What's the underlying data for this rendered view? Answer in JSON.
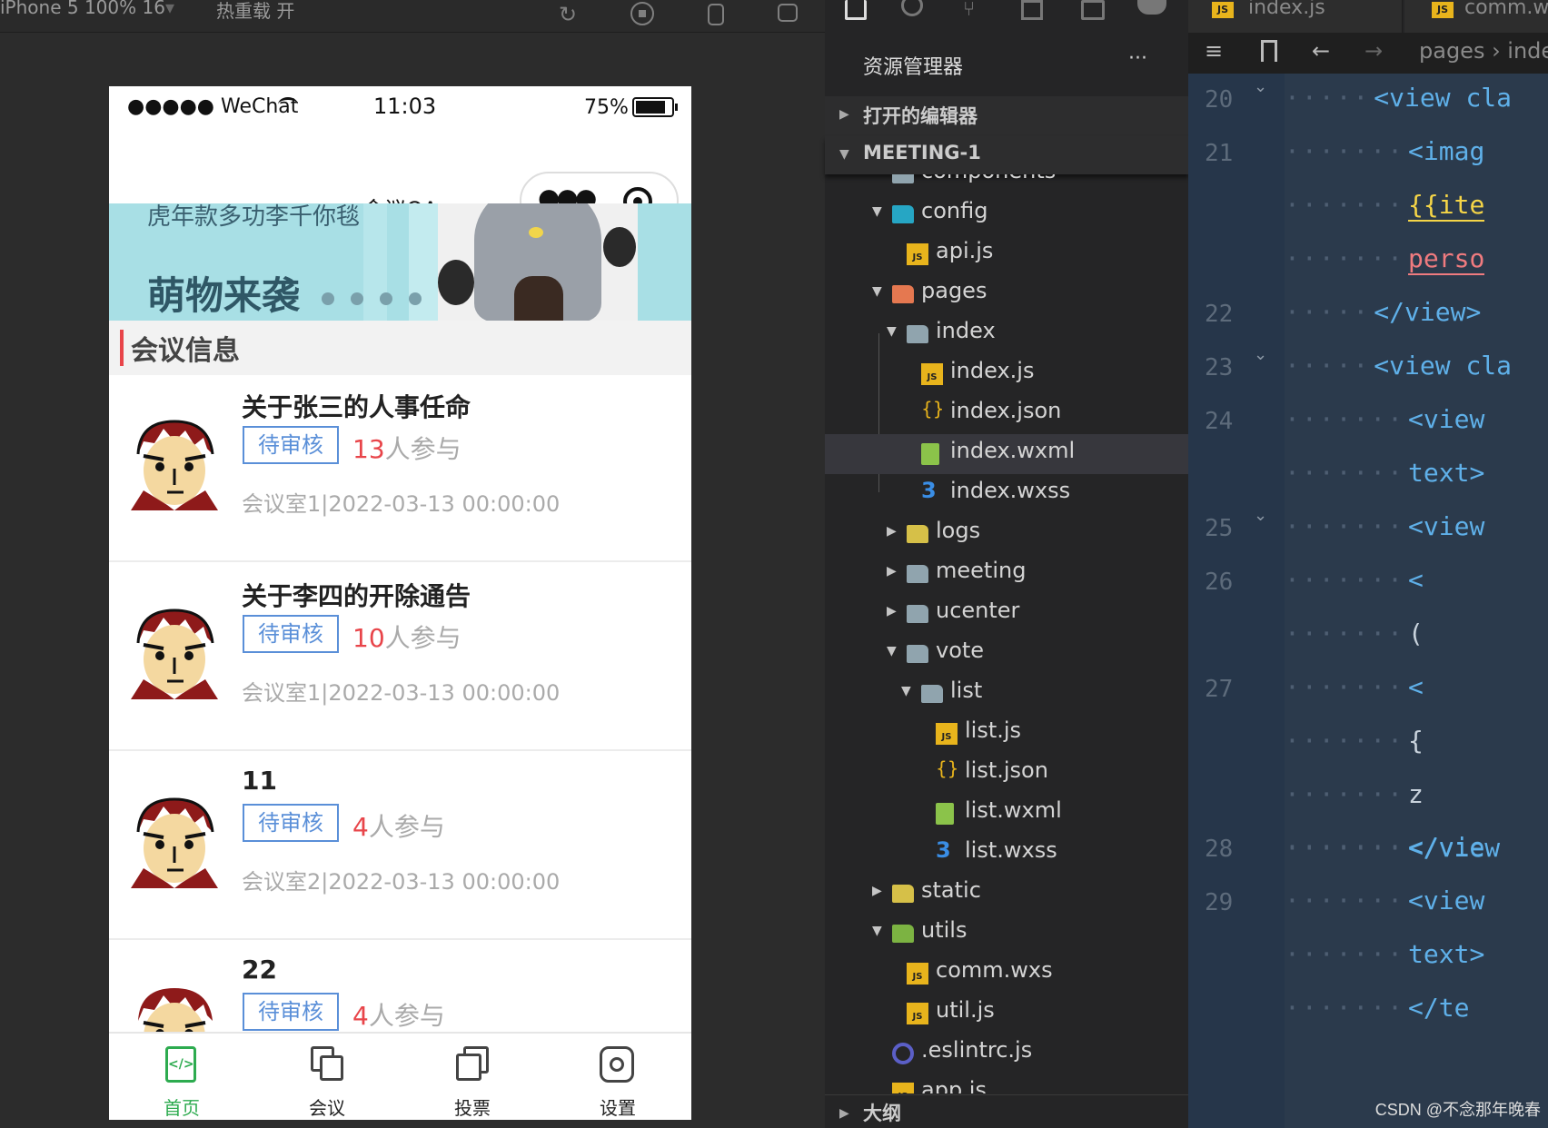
{
  "simulator_bar": {
    "device": "iPhone 5 100% 16",
    "reload": "热重载 开"
  },
  "phone": {
    "status": {
      "carrier": "●●●●● WeChat",
      "time": "11:03",
      "battery": "75%"
    },
    "nav_title": "会议OA",
    "banner": {
      "subtitle": "虎年款多功李千你毯",
      "title": "萌物来袭"
    },
    "section_title": "会议信息",
    "meetings": [
      {
        "title": "关于张三的人事任命",
        "status": "待审核",
        "count": "13",
        "count_suffix": "人参与",
        "meta": "会议室1|2022-03-13 00:00:00"
      },
      {
        "title": "关于李四的开除通告",
        "status": "待审核",
        "count": "10",
        "count_suffix": "人参与",
        "meta": "会议室1|2022-03-13 00:00:00"
      },
      {
        "title": "11",
        "status": "待审核",
        "count": "4",
        "count_suffix": "人参与",
        "meta": "会议室2|2022-03-13 00:00:00"
      },
      {
        "title": "22",
        "status": "待审核",
        "count": "4",
        "count_suffix": "人参与",
        "meta": ""
      }
    ],
    "tabs": [
      {
        "label": "首页",
        "icon": "home-code-icon",
        "active": true
      },
      {
        "label": "会议",
        "icon": "meeting-icon",
        "active": false
      },
      {
        "label": "投票",
        "icon": "vote-icon",
        "active": false
      },
      {
        "label": "设置",
        "icon": "settings-icon",
        "active": false
      }
    ],
    "accent_color": "#2dab4f"
  },
  "explorer": {
    "title": "资源管理器",
    "more": "···",
    "open_editors": "打开的编辑器",
    "project": "MEETING-1",
    "outline": "大纲",
    "tree": [
      {
        "label": "components",
        "type": "folder"
      },
      {
        "label": "config",
        "type": "folder-open"
      },
      {
        "label": "api.js",
        "type": "js"
      },
      {
        "label": "pages",
        "type": "folder-open"
      },
      {
        "label": "index",
        "type": "folder-open"
      },
      {
        "label": "index.js",
        "type": "js"
      },
      {
        "label": "index.json",
        "type": "json"
      },
      {
        "label": "index.wxml",
        "type": "wxml"
      },
      {
        "label": "index.wxss",
        "type": "wxss"
      },
      {
        "label": "logs",
        "type": "folder"
      },
      {
        "label": "meeting",
        "type": "folder"
      },
      {
        "label": "ucenter",
        "type": "folder"
      },
      {
        "label": "vote",
        "type": "folder-open"
      },
      {
        "label": "list",
        "type": "folder-open"
      },
      {
        "label": "list.js",
        "type": "js"
      },
      {
        "label": "list.json",
        "type": "json"
      },
      {
        "label": "list.wxml",
        "type": "wxml"
      },
      {
        "label": "list.wxss",
        "type": "wxss"
      },
      {
        "label": "static",
        "type": "folder"
      },
      {
        "label": "utils",
        "type": "folder-open"
      },
      {
        "label": "comm.wxs",
        "type": "js"
      },
      {
        "label": "util.js",
        "type": "js"
      },
      {
        "label": ".eslintrc.js",
        "type": "eslint"
      },
      {
        "label": "app.js",
        "type": "js"
      }
    ]
  },
  "editor": {
    "tabs": [
      "index.js",
      "comm.w"
    ],
    "breadcrumb": "pages › inde",
    "lines": [
      {
        "num": "20",
        "code": "<view cla"
      },
      {
        "num": "21",
        "code": "<imag"
      },
      {
        "num": "",
        "code": "{{ite"
      },
      {
        "num": "",
        "code": "perso"
      },
      {
        "num": "22",
        "code": "</view>"
      },
      {
        "num": "23",
        "code": "<view cla"
      },
      {
        "num": "24",
        "code": "<view"
      },
      {
        "num": "",
        "code": "text>"
      },
      {
        "num": "25",
        "code": "<view"
      },
      {
        "num": "26",
        "code": "<"
      },
      {
        "num": "",
        "code": "("
      },
      {
        "num": "27",
        "code": "<"
      },
      {
        "num": "",
        "code": "{"
      },
      {
        "num": "",
        "code": "z"
      },
      {
        "num": "",
        "code": "</view"
      },
      {
        "num": "28",
        "code": "</vie"
      },
      {
        "num": "29",
        "code": "<view"
      },
      {
        "num": "",
        "code": "text>"
      },
      {
        "num": "",
        "code": "</te"
      }
    ]
  },
  "watermark": "CSDN @不念那年晚春"
}
